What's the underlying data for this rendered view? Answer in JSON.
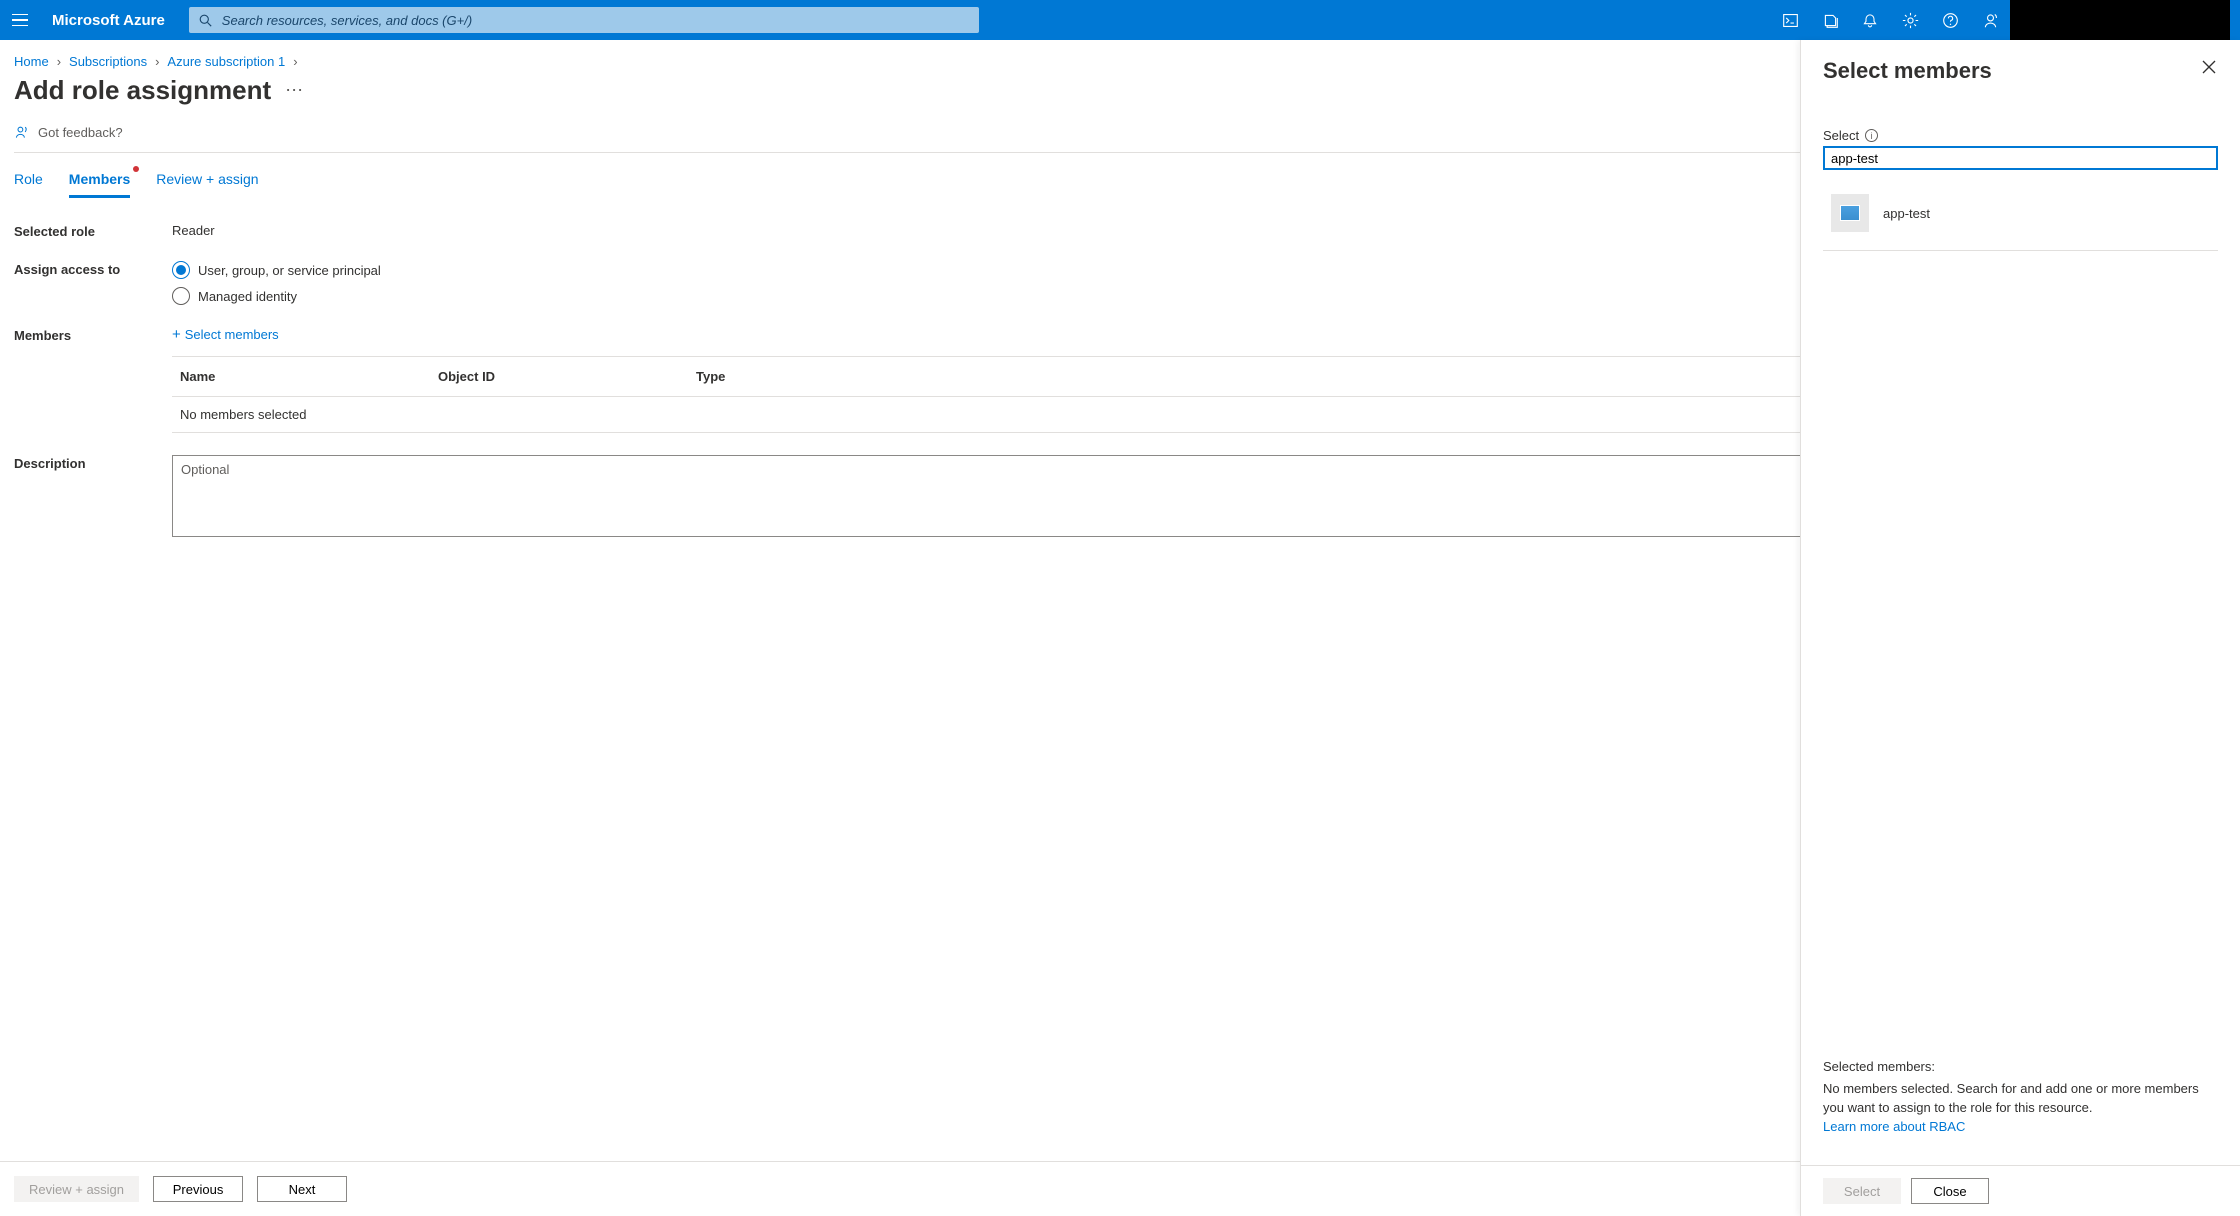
{
  "topbar": {
    "brand": "Microsoft Azure",
    "search_placeholder": "Search resources, services, and docs (G+/)"
  },
  "breadcrumbs": {
    "items": [
      {
        "label": "Home"
      },
      {
        "label": "Subscriptions"
      },
      {
        "label": "Azure subscription 1"
      }
    ]
  },
  "page": {
    "title": "Add role assignment",
    "feedback": "Got feedback?"
  },
  "tabs": {
    "role": "Role",
    "members": "Members",
    "review": "Review + assign"
  },
  "form": {
    "selected_role_label": "Selected role",
    "selected_role_value": "Reader",
    "assign_access_label": "Assign access to",
    "assign_option_user": "User, group, or service principal",
    "assign_option_managed": "Managed identity",
    "members_label": "Members",
    "select_members_link": "Select members",
    "table": {
      "col_name": "Name",
      "col_object": "Object ID",
      "col_type": "Type",
      "empty": "No members selected"
    },
    "description_label": "Description",
    "description_placeholder": "Optional"
  },
  "footer": {
    "review": "Review + assign",
    "previous": "Previous",
    "next": "Next"
  },
  "panel": {
    "title": "Select members",
    "select_label": "Select",
    "search_value": "app-test",
    "results": [
      {
        "name": "app-test"
      }
    ],
    "selected_heading": "Selected members:",
    "selected_text": "No members selected. Search for and add one or more members you want to assign to the role for this resource.",
    "learn_more": "Learn more about RBAC",
    "select_button": "Select",
    "close_button": "Close"
  }
}
